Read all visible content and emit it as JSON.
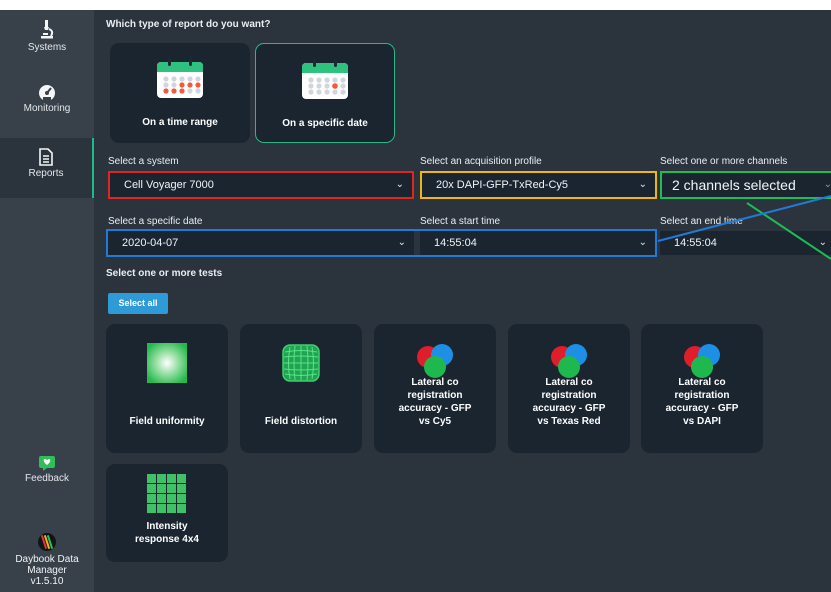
{
  "sidebar": {
    "items": [
      {
        "label": "Systems",
        "icon": "microscope-icon"
      },
      {
        "label": "Monitoring",
        "icon": "speedometer-icon"
      },
      {
        "label": "Reports",
        "icon": "document-icon",
        "active": true
      }
    ],
    "feedback": {
      "label": "Feedback",
      "icon": "heart-chat-icon"
    },
    "app_name_line1": "Daybook Data",
    "app_name_line2": "Manager",
    "app_version": "v1.5.10"
  },
  "report_type": {
    "question": "Which type of report do you want?",
    "options": [
      {
        "label": "On a time range",
        "selected": false
      },
      {
        "label": "On a specific date",
        "selected": true
      }
    ]
  },
  "form": {
    "system": {
      "label": "Select a system",
      "value": "Cell Voyager 7000"
    },
    "profile": {
      "label": "Select an acquisition profile",
      "value": "20x DAPI-GFP-TxRed-Cy5"
    },
    "channels": {
      "label": "Select one or more channels",
      "value": "2 channels selected"
    },
    "date": {
      "label": "Select a specific date",
      "value": "2020-04-07"
    },
    "start_time": {
      "label": "Select a start time",
      "value": "14:55:04"
    },
    "end_time": {
      "label": "Select an end time",
      "value": "14:55:04"
    }
  },
  "tests": {
    "label": "Select one or more tests",
    "select_all": "Select all",
    "items": [
      {
        "label": "Field uniformity",
        "icon": "gradient-square-icon"
      },
      {
        "label": "Field distortion",
        "icon": "distortion-grid-icon"
      },
      {
        "label": "Lateral co registration accuracy - GFP vs Cy5",
        "line1": "Lateral co",
        "line2": "registration",
        "line3": "accuracy - GFP",
        "line4": "vs Cy5",
        "icon": "rgb-circles-icon"
      },
      {
        "label": "Lateral co registration accuracy - GFP vs Texas Red",
        "line1": "Lateral co",
        "line2": "registration",
        "line3": "accuracy - GFP",
        "line4": "vs Texas Red",
        "icon": "rgb-circles-icon"
      },
      {
        "label": "Lateral co registration accuracy - GFP vs DAPI",
        "line1": "Lateral co",
        "line2": "registration",
        "line3": "accuracy - GFP",
        "line4": "vs DAPI",
        "icon": "rgb-circles-icon"
      },
      {
        "label": "Intensity response 4x4",
        "line1": "Intensity",
        "line2": "response 4x4",
        "icon": "green-grid-icon"
      }
    ]
  },
  "colors": {
    "background": "#2b343d",
    "sidebar": "#38414a",
    "card": "#1a2530",
    "accent_green": "#2ab985",
    "annotation_red": "#e02525",
    "annotation_yellow": "#f0b415",
    "annotation_green": "#1fbb55",
    "annotation_blue": "#2379d6"
  }
}
